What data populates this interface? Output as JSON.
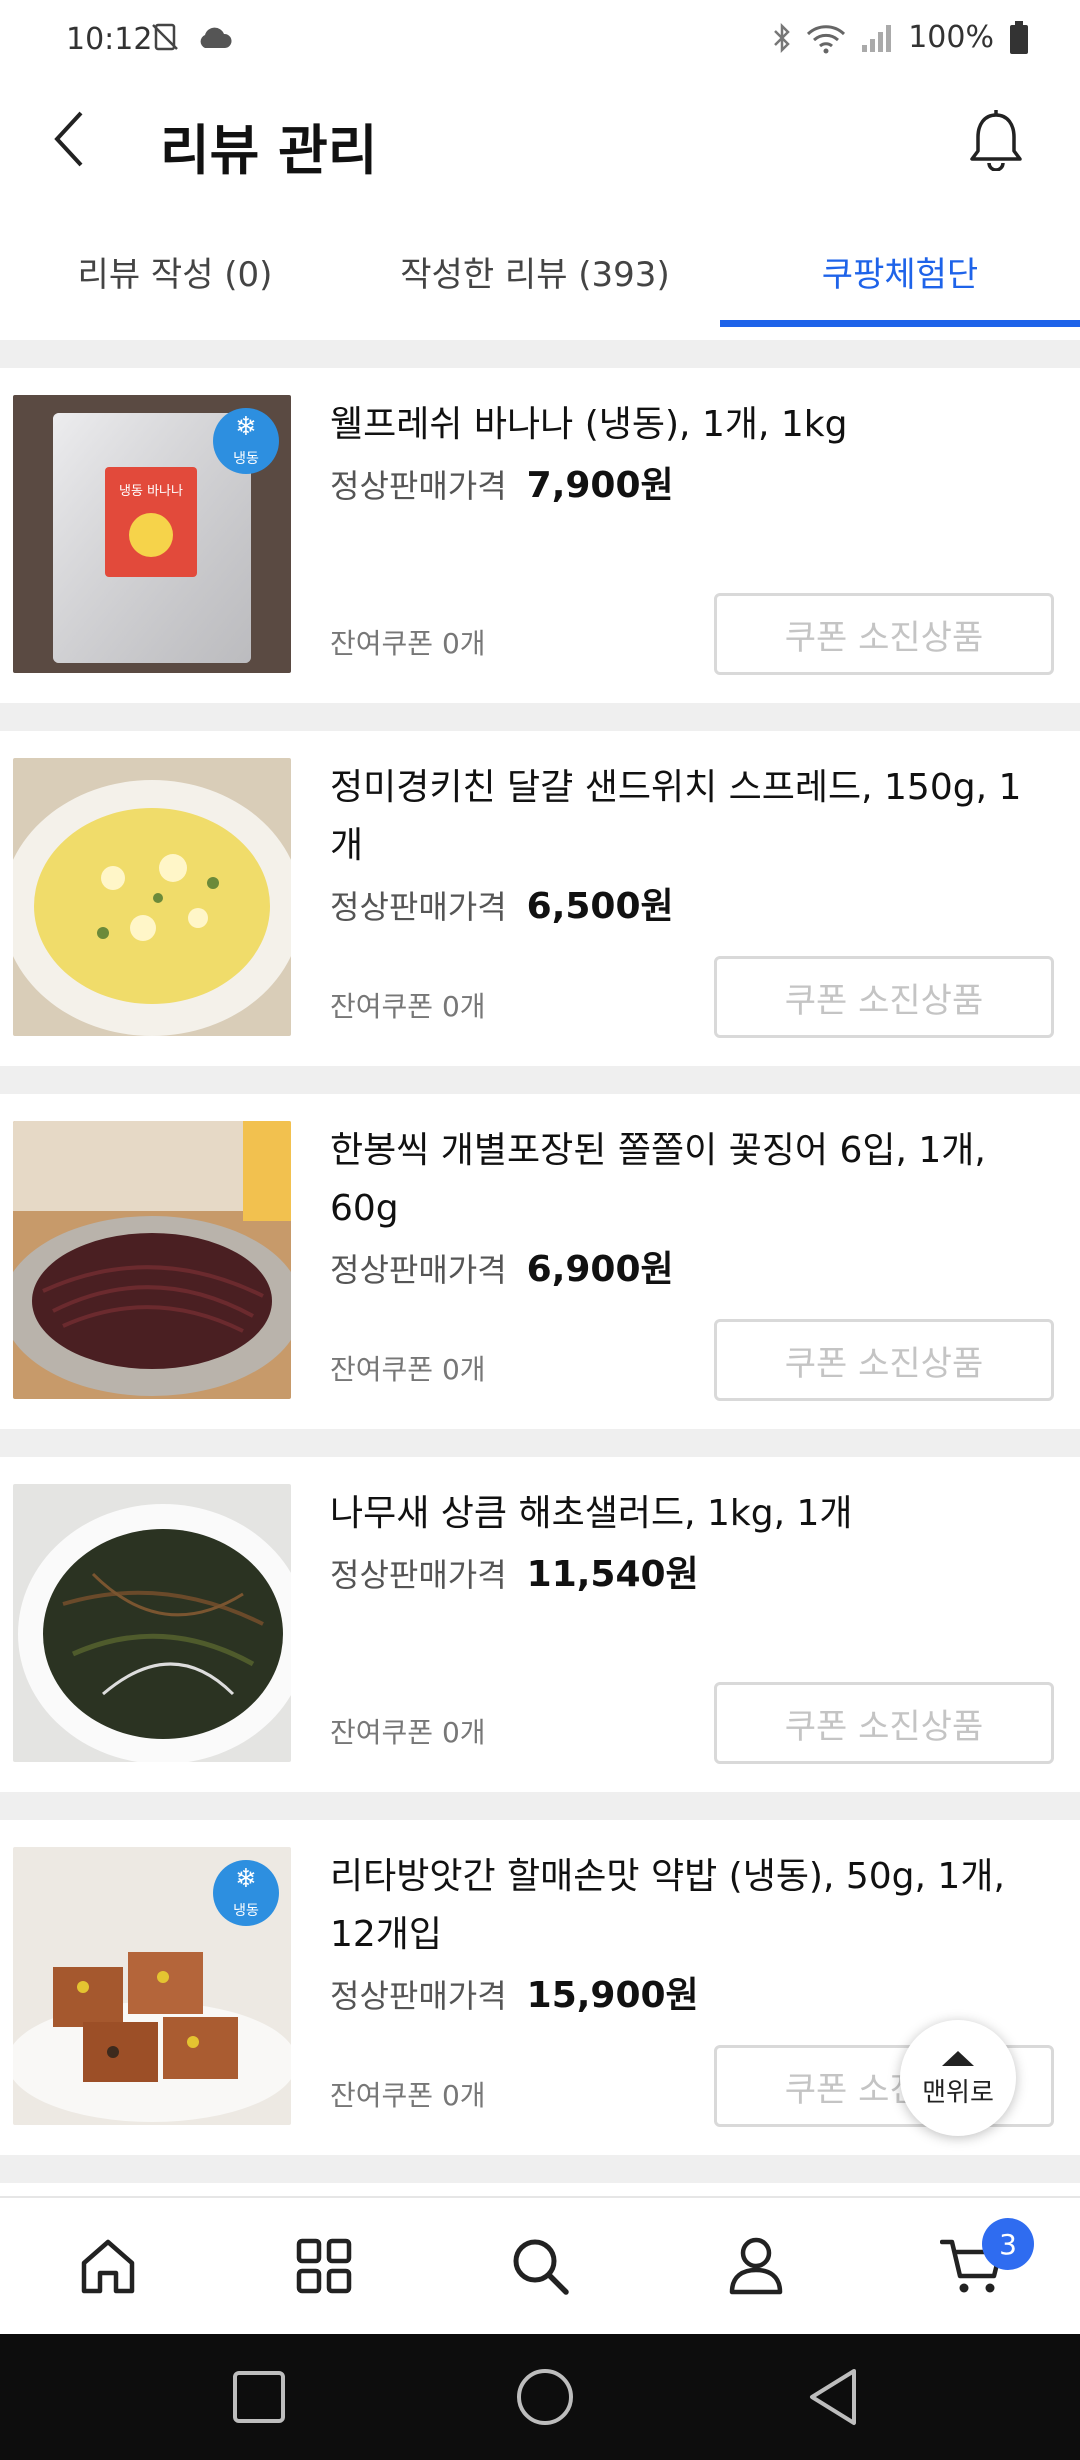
{
  "status_bar": {
    "time": "10:12",
    "battery": "100%"
  },
  "header": {
    "title": "리뷰 관리"
  },
  "tabs": [
    {
      "label": "리뷰 작성 (0)"
    },
    {
      "label": "작성한 리뷰 (393)"
    },
    {
      "label": "쿠팡체험단"
    }
  ],
  "common": {
    "price_label": "정상판매가격",
    "coupon_button": "쿠폰 소진상품"
  },
  "products": [
    {
      "name": "웰프레쉬 바나나 (냉동), 1개, 1kg",
      "price": "7,900원",
      "coupons_left": "잔여쿠폰 0개",
      "frozen_badge": "냉동"
    },
    {
      "name": "정미경키친 달걀 샌드위치 스프레드, 150g, 1개",
      "price": "6,500원",
      "coupons_left": "잔여쿠폰 0개"
    },
    {
      "name": "한봉씩 개별포장된 쫄쫄이 꽃징어 6입, 1개, 60g",
      "price": "6,900원",
      "coupons_left": "잔여쿠폰 0개"
    },
    {
      "name": "나무새 상큼 해초샐러드, 1kg, 1개",
      "price": "11,540원",
      "coupons_left": "잔여쿠폰 0개"
    },
    {
      "name": "리타방앗간 할매손맛 약밥 (냉동), 50g, 1개, 12개입",
      "price": "15,900원",
      "coupons_left": "잔여쿠폰 0개",
      "frozen_badge": "냉동"
    }
  ],
  "product1_package_text": "냉동 바나나",
  "scroll_top": {
    "label": "맨위로"
  },
  "bottom_nav": {
    "cart_count": "3"
  },
  "colors": {
    "accent": "#1e63e9",
    "badge": "#2f6cf0"
  }
}
